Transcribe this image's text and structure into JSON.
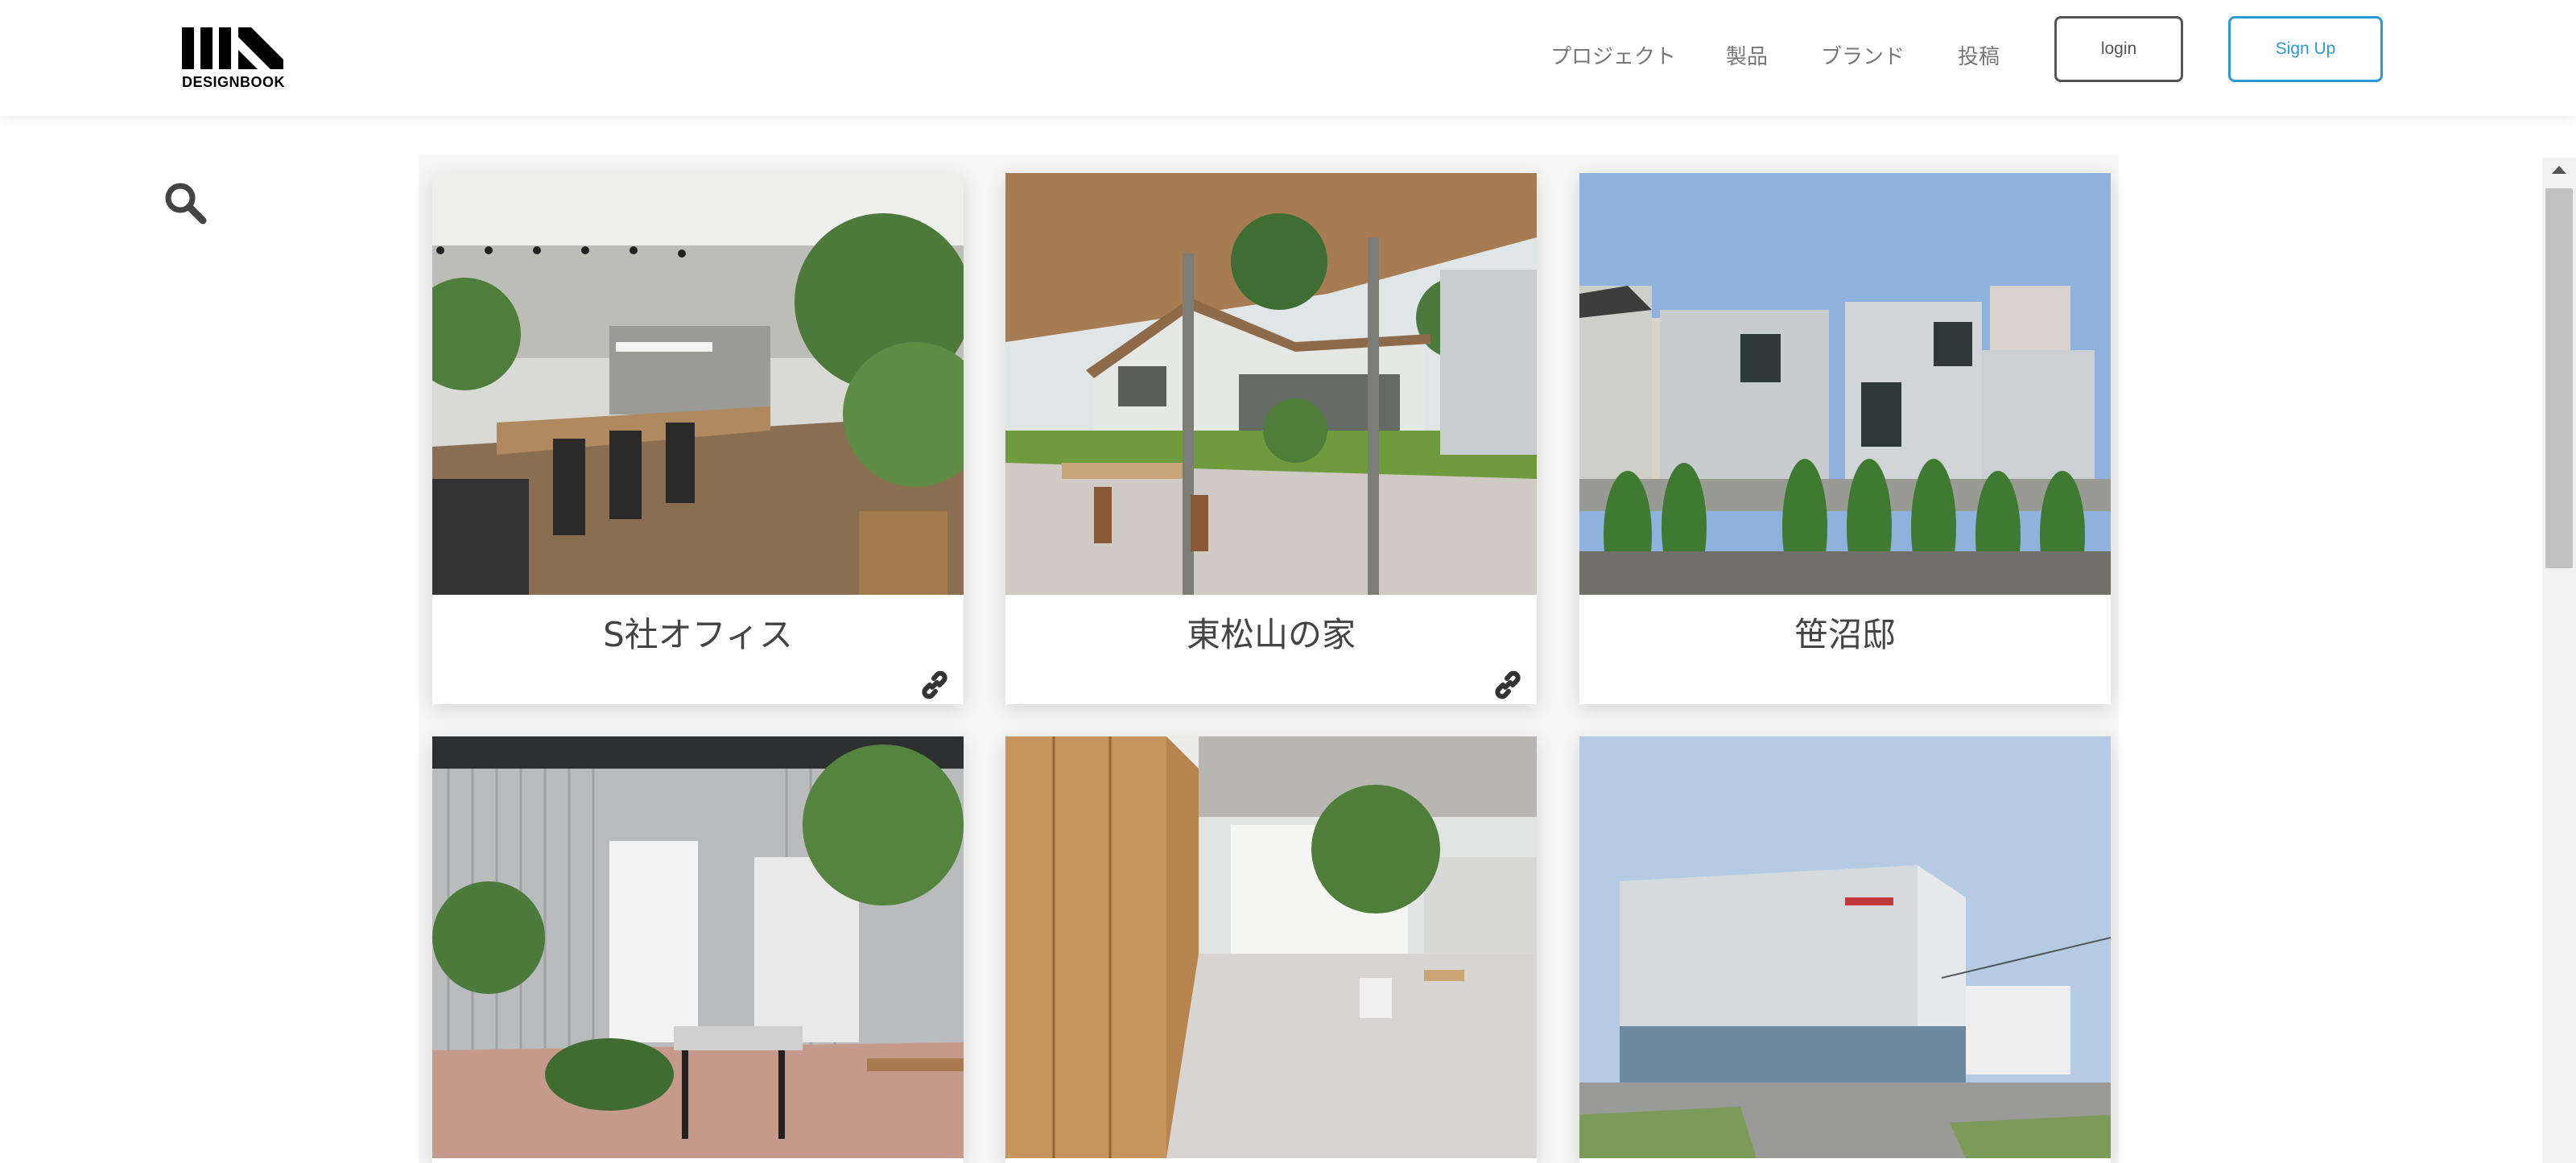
{
  "brand": {
    "name": "DESIGNBOOK",
    "logo_icon": "designbook-logo-icon"
  },
  "nav": {
    "items": [
      {
        "label": "プロジェクト"
      },
      {
        "label": "製品"
      },
      {
        "label": "ブランド"
      },
      {
        "label": "投稿"
      }
    ],
    "login_label": "login",
    "signup_label": "Sign Up",
    "signup_color": "#2a9ad8"
  },
  "search": {
    "icon": "search-icon"
  },
  "projects": [
    {
      "title": "S社オフィス",
      "has_link": true,
      "photo": "office interior with plants"
    },
    {
      "title": "東松山の家",
      "has_link": true,
      "photo": "house with covered terrace"
    },
    {
      "title": "笹沼邸",
      "has_link": false,
      "photo": "white house exterior with hedges"
    },
    {
      "title": "",
      "has_link": false,
      "photo": "office with corrugated metal walls and plants"
    },
    {
      "title": "",
      "has_link": false,
      "photo": "interior with wooden wall and plant"
    },
    {
      "title": "",
      "has_link": false,
      "photo": "white building with glass storefront"
    }
  ],
  "scrollbar": {
    "position": 0.0
  }
}
